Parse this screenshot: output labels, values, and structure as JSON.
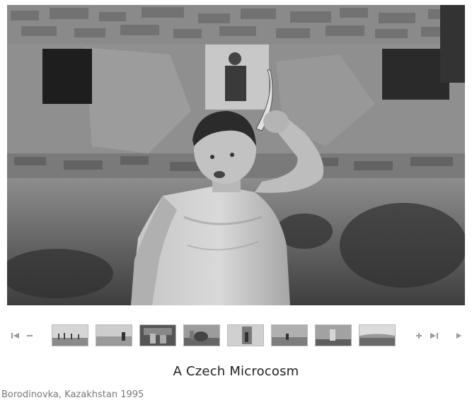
{
  "gallery": {
    "title": "A Czech Microcosm",
    "caption": "Borodinovka, Kazakhstan 1995",
    "colors": {
      "background": "#ffffff",
      "title_text": "#222222",
      "caption_text": "#777777",
      "nav_icon": "#9a9a9a"
    },
    "main_photo": {
      "subject": "boy-holding-object-over-head",
      "tone": "black-and-white"
    },
    "nav": {
      "first_icon": "skip-to-start-icon",
      "prev_icon": "minus-icon",
      "next_icon": "plus-icon",
      "last_icon": "skip-to-end-icon",
      "play_icon": "play-icon"
    },
    "thumbnails": [
      {
        "index": 1,
        "tone": "light"
      },
      {
        "index": 2,
        "tone": "light"
      },
      {
        "index": 3,
        "tone": "dark"
      },
      {
        "index": 4,
        "tone": "mid"
      },
      {
        "index": 5,
        "tone": "light"
      },
      {
        "index": 6,
        "tone": "mid"
      },
      {
        "index": 7,
        "tone": "mid"
      },
      {
        "index": 8,
        "tone": "light"
      }
    ]
  }
}
